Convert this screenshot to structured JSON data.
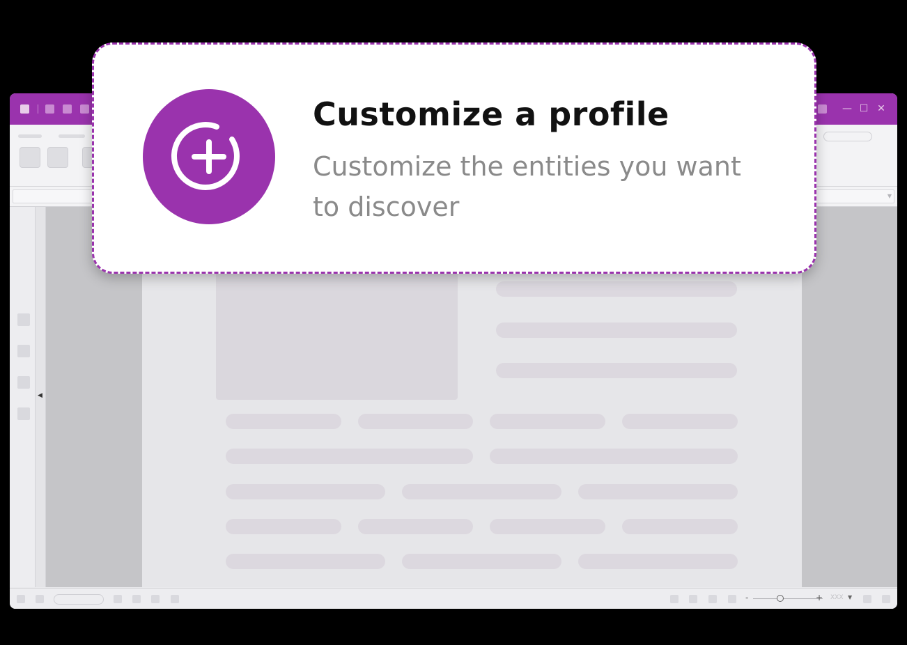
{
  "app": {
    "statusbar": {
      "zoom_minus": "-",
      "zoom_plus": "+",
      "zoom_value": "XXX"
    },
    "titlebar": {
      "minimize": "—",
      "maximize": "☐",
      "close": "✕"
    }
  },
  "callout": {
    "title": "Customize a profile",
    "subtitle": "Customize the entities you want to discover",
    "icon": "add-circle-icon",
    "accent_color": "#9a33ad"
  }
}
